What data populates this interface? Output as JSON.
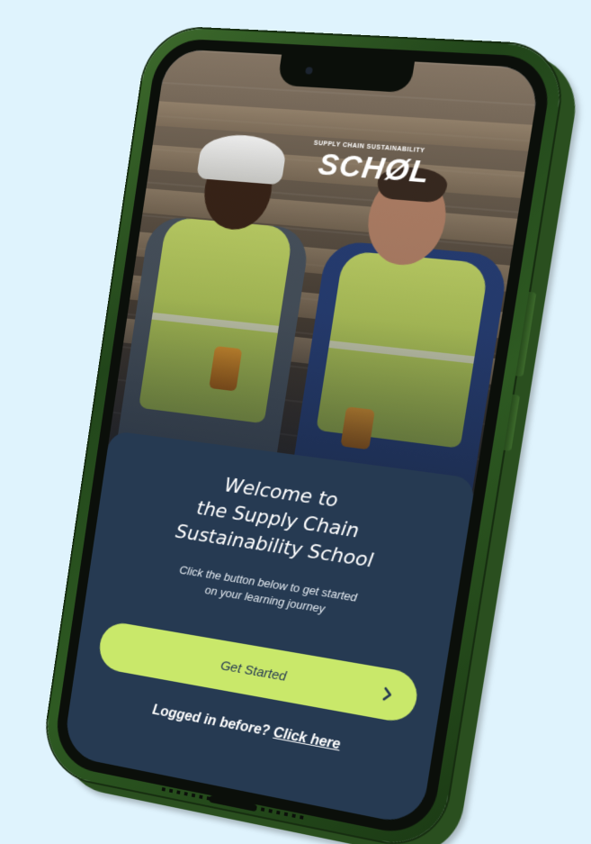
{
  "app": {
    "logo_subtitle": "SUPPLY CHAIN SUSTAINABILITY",
    "logo_main": "SCHØL"
  },
  "welcome": {
    "title_lines": [
      "Welcome to",
      "the Supply Chain",
      "Sustainability School"
    ],
    "subtitle_lines": [
      "Click the button below to get started",
      "on your learning journey"
    ]
  },
  "actions": {
    "get_started_label": "Get Started",
    "chevron_icon": "chevron-right-icon",
    "login_prompt": "Logged in before?",
    "login_link": "Click here"
  },
  "colors": {
    "background": "#dff3fd",
    "phone_frame": "#2e5a22",
    "card": "#263a52",
    "accent_button": "#c9e86a",
    "text": "#ffffff"
  }
}
